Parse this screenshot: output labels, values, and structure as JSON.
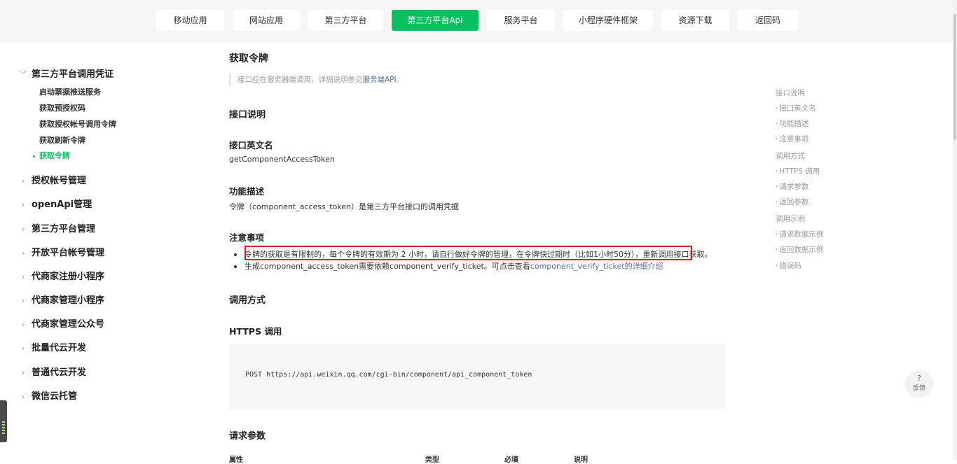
{
  "topnav": {
    "tabs": [
      {
        "label": "移动应用"
      },
      {
        "label": "网站应用"
      },
      {
        "label": "第三方平台"
      },
      {
        "label": "第三方平台Api",
        "active": true
      },
      {
        "label": "服务平台"
      },
      {
        "label": "小程序硬件框架"
      },
      {
        "label": "资源下载"
      },
      {
        "label": "返回码"
      }
    ]
  },
  "sidebar": {
    "expanded": {
      "label": "第三方平台调用凭证",
      "children": [
        "启动票据推送服务",
        "获取预授权码",
        "获取授权帐号调用令牌",
        "获取刷新令牌",
        "获取令牌"
      ]
    },
    "sections": [
      "授权帐号管理",
      "openApi管理",
      "第三方平台管理",
      "开放平台帐号管理",
      "代商家注册小程序",
      "代商家管理小程序",
      "代商家管理公众号",
      "批量代云开发",
      "普通代云开发",
      "微信云托管"
    ]
  },
  "main": {
    "title": "获取令牌",
    "quote_prefix": "接口应在服务器端调用，详细说明参见",
    "quote_link": "服务端API",
    "quote_suffix": "。",
    "h_interface": "接口说明",
    "h_english_name": "接口英文名",
    "english_name": "getComponentAccessToken",
    "h_function": "功能描述",
    "function_desc": "令牌（component_access_token）是第三方平台接口的调用凭据",
    "h_notes": "注意事项",
    "note1": "令牌的获取是有限制的，每个令牌的有效期为 2 小时，请自行做好令牌的管理，在令牌快过期时（比如1小时50分），重新调用接口获取。",
    "note2_prefix": "生成component_access_token需要依赖component_verify_ticket。可点击查看",
    "note2_link": "component_verify_ticket的详细介绍",
    "h_call": "调用方式",
    "h_https": "HTTPS 调用",
    "code": "POST https://api.weixin.qq.com/cgi-bin/component/api_component_token",
    "h_params": "请求参数",
    "table_headers": [
      "属性",
      "类型",
      "必填",
      "说明"
    ]
  },
  "toc": {
    "items": [
      {
        "label": "接口说明",
        "level": 1
      },
      {
        "label": "接口英文名",
        "level": 2
      },
      {
        "label": "功能描述",
        "level": 2
      },
      {
        "label": "注意事项",
        "level": 2
      },
      {
        "label": "调用方式",
        "level": 1
      },
      {
        "label": "HTTPS 调用",
        "level": 2
      },
      {
        "label": "请求参数",
        "level": 2
      },
      {
        "label": "返回参数",
        "level": 2
      },
      {
        "label": "调用示例",
        "level": 1
      },
      {
        "label": "请求数据示例",
        "level": 2
      },
      {
        "label": "返回数据示例",
        "level": 2
      },
      {
        "label": "错误码",
        "level": 2
      }
    ]
  },
  "feedback": {
    "icon": "question-icon",
    "symbol": "?",
    "label": "反馈"
  },
  "colors": {
    "accent": "#07c160",
    "link": "#576b95",
    "highlight_box": "#e0191e"
  }
}
